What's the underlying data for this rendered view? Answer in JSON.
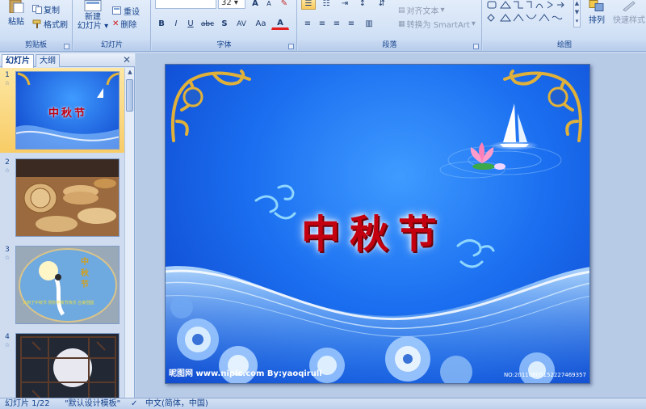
{
  "ribbon": {
    "clipboard": {
      "label": "剪贴板",
      "paste": "粘贴",
      "copy": "复制",
      "format_painter": "格式刷"
    },
    "slides": {
      "label": "幻灯片",
      "new_slide_line1": "新建",
      "new_slide_line2": "幻灯片",
      "reset": "重设",
      "delete": "删除"
    },
    "font": {
      "label": "字体",
      "size": "32",
      "bold": "B",
      "italic": "I",
      "underline": "U",
      "strike": "abc",
      "shadow": "S",
      "spacing": "AV",
      "case": "Aa",
      "grow": "A",
      "shrink": "A"
    },
    "paragraph": {
      "label": "段落",
      "align_text": "对齐文本",
      "smartart": "转换为 SmartArt"
    },
    "drawing": {
      "label": "绘图",
      "arrange": "排列",
      "quick_styles": "快速样式"
    }
  },
  "pane": {
    "tab_slides": "幻灯片",
    "tab_outline": "大纲",
    "close": "✕",
    "thumbnails": [
      {
        "number": "1",
        "title": "中秋节"
      },
      {
        "number": "2"
      },
      {
        "number": "3",
        "title_chars": [
          "中",
          "秋",
          "节"
        ],
        "caption": "又到了中秋节 祝你中秋节快乐 合家团圆"
      },
      {
        "number": "4"
      }
    ]
  },
  "slide": {
    "title": "中秋节",
    "watermark_left": "昵图网 www.nipic.com  By:yaoqiruli",
    "watermark_right": "NO:20110805152227469357"
  },
  "status": {
    "slide_counter": "幻灯片 1/22",
    "theme": "\"默认设计模板\"",
    "language": "中文(简体，中国)"
  }
}
